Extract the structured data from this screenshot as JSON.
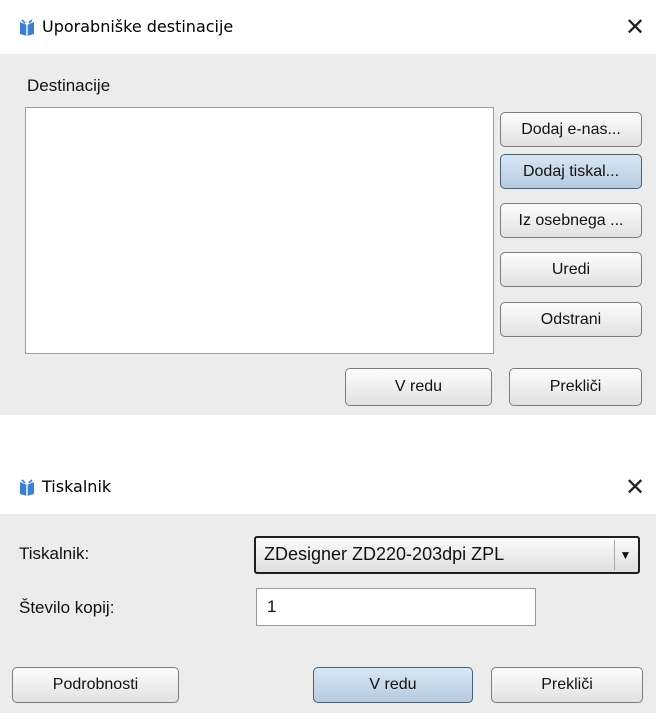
{
  "dialog1": {
    "title": "Uporabniške destinacije",
    "close_glyph": "✕",
    "destinations_label": "Destinacije",
    "destinations_items": [],
    "buttons": {
      "add_email": "Dodaj e-nas...",
      "add_printer": "Dodaj tiskal...",
      "from_personal": "Iz osebnega ...",
      "edit": "Uredi",
      "remove": "Odstrani",
      "ok": "V redu",
      "cancel": "Prekliči"
    }
  },
  "dialog2": {
    "title": "Tiskalnik",
    "close_glyph": "✕",
    "printer_label": "Tiskalnik:",
    "printer_selected": "ZDesigner ZD220-203dpi ZPL",
    "copies_label": "Število kopij:",
    "copies_value": "1",
    "buttons": {
      "details": "Podrobnosti",
      "ok": "V redu",
      "cancel": "Prekliči"
    }
  },
  "icons": {
    "app_icon": "app-logo-icon",
    "close": "close-icon",
    "dropdown": "chevron-down-icon"
  },
  "colors": {
    "dialog_bg": "#ececec",
    "titlebar_bg": "#ffffff",
    "focused_button": "#b6cbe0",
    "app_icon_blue": "#3a7fd5"
  }
}
